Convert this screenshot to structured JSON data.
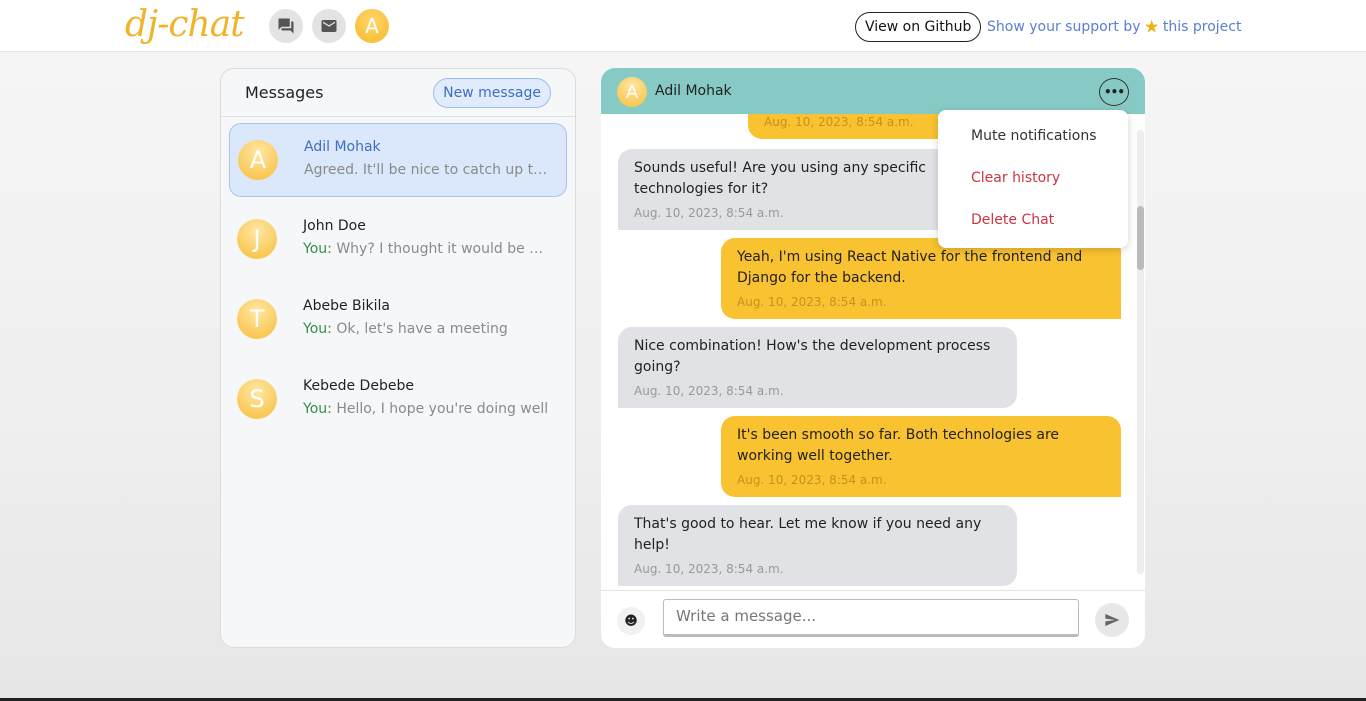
{
  "header": {
    "logo": "dj-chat",
    "github_label": "View on Github",
    "support_prefix": "Show your support by",
    "support_suffix": "this project",
    "avatar_letter": "A",
    "nav_icons": [
      "forum-icon",
      "mail-icon"
    ]
  },
  "messages_panel": {
    "title": "Messages",
    "new_message_label": "New message",
    "conversations": [
      {
        "letter": "A",
        "name": "Adil Mohak",
        "you": "",
        "preview": "Agreed. It'll be nice to catch up th...",
        "active": true
      },
      {
        "letter": "J",
        "name": "John Doe",
        "you": "You:",
        "preview": "Why? I thought it would be g..."
      },
      {
        "letter": "T",
        "name": "Abebe Bikila",
        "you": "You:",
        "preview": "Ok, let's have a meeting"
      },
      {
        "letter": "S",
        "name": "Kebede Debebe",
        "you": "You:",
        "preview": "Hello, I hope you're doing well"
      }
    ]
  },
  "chat": {
    "contact_letter": "A",
    "contact_name": "Adil Mohak",
    "messages": [
      {
        "dir": "out",
        "text": "",
        "time": "Aug. 10, 2023, 8:54 a.m."
      },
      {
        "dir": "in",
        "text": "Sounds useful! Are you using any specific technologies for it?",
        "time": "Aug. 10, 2023, 8:54 a.m."
      },
      {
        "dir": "out",
        "text": "Yeah, I'm using React Native for the frontend and Django for the backend.",
        "time": "Aug. 10, 2023, 8:54 a.m."
      },
      {
        "dir": "in",
        "text": "Nice combination! How's the development process going?",
        "time": "Aug. 10, 2023, 8:54 a.m."
      },
      {
        "dir": "out",
        "text": "It's been smooth so far. Both technologies are working well together.",
        "time": "Aug. 10, 2023, 8:54 a.m."
      },
      {
        "dir": "in",
        "text": "That's good to hear. Let me know if you need any help!",
        "time": "Aug. 10, 2023, 8:54 a.m."
      }
    ],
    "input_placeholder": "Write a message...",
    "menu": {
      "mute": "Mute notifications",
      "clear": "Clear history",
      "delete": "Delete Chat"
    }
  },
  "colors": {
    "accent_yellow": "#f9c230",
    "chat_header": "#87cac5",
    "link_blue": "#5a7fd0",
    "danger": "#cc3342"
  }
}
